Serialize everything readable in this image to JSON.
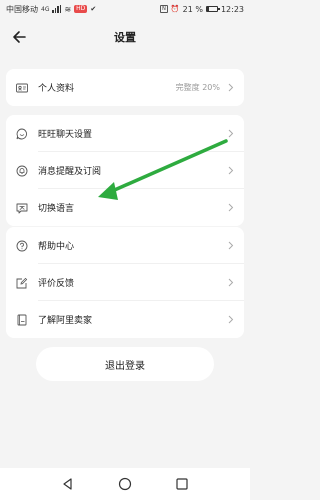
{
  "status_bar": {
    "carrier": "中国移动",
    "network": "4G",
    "badge": "HD",
    "nfc": "N",
    "battery_percent": "21 %",
    "battery_level": 0.21,
    "time": "12:23"
  },
  "header": {
    "title": "设置",
    "back_icon": "back-arrow-icon"
  },
  "groups": [
    {
      "items": [
        {
          "label": "个人资料",
          "value": "完整度 20%",
          "icon": "id-card-icon"
        }
      ]
    },
    {
      "items": [
        {
          "label": "旺旺聊天设置",
          "icon": "chat-smile-icon"
        },
        {
          "label": "消息提醒及订阅",
          "icon": "bell-icon"
        },
        {
          "label": "切换语言",
          "icon": "language-icon"
        }
      ]
    },
    {
      "items": [
        {
          "label": "帮助中心",
          "icon": "question-icon"
        },
        {
          "label": "评价反馈",
          "icon": "edit-icon"
        },
        {
          "label": "了解阿里卖家",
          "icon": "book-icon"
        }
      ]
    }
  ],
  "logout_label": "退出登录",
  "annotation_color": "#2eab3f",
  "nav_bar": {
    "back": "triangle-back-icon",
    "home": "circle-home-icon",
    "recent": "square-recent-icon"
  }
}
